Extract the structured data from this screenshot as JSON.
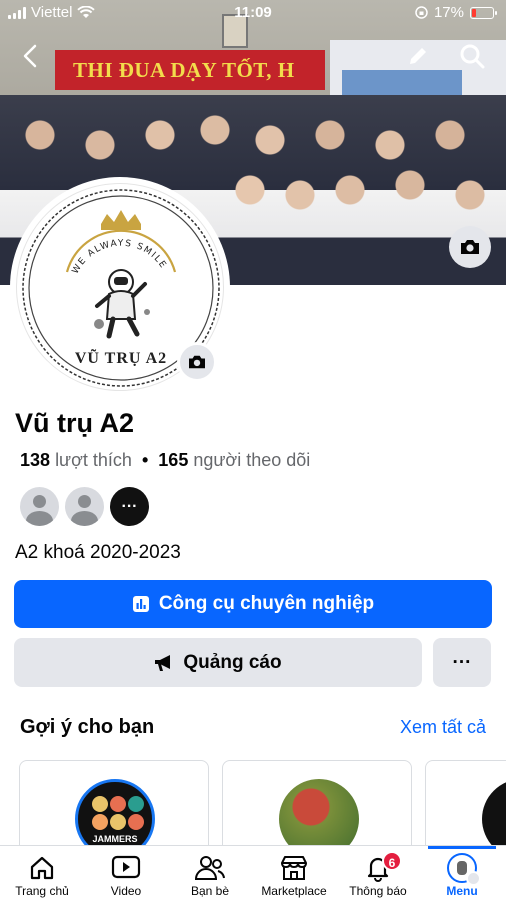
{
  "status_bar": {
    "carrier": "Viettel",
    "time": "11:09",
    "battery": "17%"
  },
  "cover": {
    "banner_text": "THI ĐUA DẠY TỐT, H"
  },
  "avatar": {
    "arc_text": "WE ALWAYS SMILE",
    "logo_text": "VŨ TRỤ A2"
  },
  "profile": {
    "name": "Vũ trụ A2",
    "likes_count": "138",
    "likes_label": "lượt thích",
    "separator": "•",
    "followers_count": "165",
    "followers_label": "người theo dõi",
    "bio": "A2 khoá 2020-2023"
  },
  "actions": {
    "pro_tools_label": "Công cụ chuyên nghiệp",
    "ads_label": "Quảng cáo",
    "more_label": "···"
  },
  "suggestions": {
    "title": "Gợi ý cho bạn",
    "see_all": "Xem tất cả",
    "card1_logo_text": "JAMMERS"
  },
  "bottom_nav": [
    {
      "label": "Trang chủ",
      "icon": "home-icon"
    },
    {
      "label": "Video",
      "icon": "video-icon"
    },
    {
      "label": "Bạn bè",
      "icon": "friends-icon"
    },
    {
      "label": "Marketplace",
      "icon": "marketplace-icon"
    },
    {
      "label": "Thông báo",
      "icon": "bell-icon",
      "badge": "6"
    },
    {
      "label": "Menu",
      "icon": "menu-avatar-icon",
      "active": true
    }
  ],
  "colors": {
    "accent": "#0866ff",
    "badge": "#e41e3f",
    "button_gray": "#e4e6eb"
  }
}
